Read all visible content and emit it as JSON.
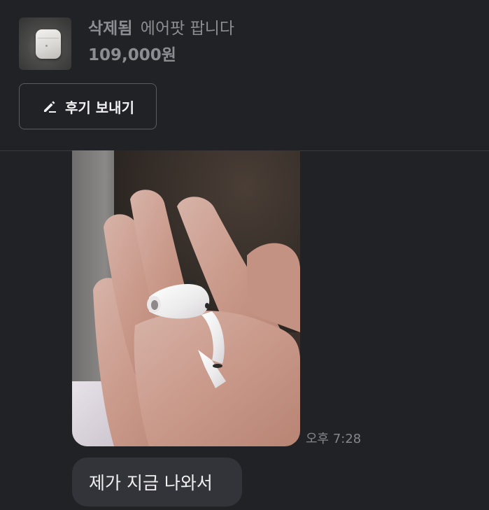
{
  "product": {
    "status": "삭제됨",
    "title": "에어팟 팝니다",
    "price": "109,000원",
    "thumbnail": "airpods-case-thumbnail"
  },
  "review_button": {
    "label": "후기 보내기",
    "icon": "pencil-icon"
  },
  "messages": [
    {
      "type": "image",
      "content": "photo-airpods-pro-earbud-in-hand",
      "time": "오후 7:28"
    },
    {
      "type": "text",
      "text": "제가 지금 나와서"
    }
  ],
  "colors": {
    "background": "#212226",
    "bubble": "#33343a",
    "muted_text": "#8c8d93",
    "divider": "#3a3b40"
  }
}
